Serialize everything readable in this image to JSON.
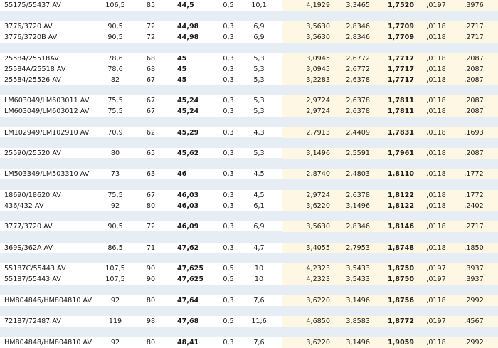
{
  "rows": [
    [
      "55175/55437 AV",
      "106,5",
      "85",
      "44,5",
      "0,5",
      "10,1",
      "4,1929",
      "3,3465",
      "1,7520",
      ",0197",
      ",3976"
    ],
    [
      "3776/3720 AV",
      "90,5",
      "72",
      "44,98",
      "0,3",
      "6,9",
      "3,5630",
      "2,8346",
      "1,7709",
      ",0118",
      ",2717"
    ],
    [
      "3776/3720B AV",
      "90,5",
      "72",
      "44,98",
      "0,3",
      "6,9",
      "3,5630",
      "2,8346",
      "1,7709",
      ",0118",
      ",2717"
    ],
    [
      "25584/25518AV",
      "78,6",
      "68",
      "45",
      "0,3",
      "5,3",
      "3,0945",
      "2,6772",
      "1,7717",
      ",0118",
      ",2087"
    ],
    [
      "25584A/25518 AV",
      "78,6",
      "68",
      "45",
      "0,3",
      "5,3",
      "3,0945",
      "2,6772",
      "1,7717",
      ",0118",
      ",2087"
    ],
    [
      "25584/25526 AV",
      "82",
      "67",
      "45",
      "0,3",
      "5,3",
      "3,2283",
      "2,6378",
      "1,7717",
      ",0118",
      ",2087"
    ],
    [
      "LM603049/LM603011 AV",
      "75,5",
      "67",
      "45,24",
      "0,3",
      "5,3",
      "2,9724",
      "2,6378",
      "1,7811",
      ",0118",
      ",2087"
    ],
    [
      "LM603049/LM603012 AV",
      "75,5",
      "67",
      "45,24",
      "0,3",
      "5,3",
      "2,9724",
      "2,6378",
      "1,7811",
      ",0118",
      ",2087"
    ],
    [
      "LM102949/LM102910 AV",
      "70,9",
      "62",
      "45,29",
      "0,3",
      "4,3",
      "2,7913",
      "2,4409",
      "1,7831",
      ",0118",
      ",1693"
    ],
    [
      "25590/25520 AV",
      "80",
      "65",
      "45,62",
      "0,3",
      "5,3",
      "3,1496",
      "2,5591",
      "1,7961",
      ",0118",
      ",2087"
    ],
    [
      "LM503349/LM503310 AV",
      "73",
      "63",
      "46",
      "0,3",
      "4,5",
      "2,8740",
      "2,4803",
      "1,8110",
      ",0118",
      ",1772"
    ],
    [
      "18690/18620 AV",
      "75,5",
      "67",
      "46,03",
      "0,3",
      "4,5",
      "2,9724",
      "2,6378",
      "1,8122",
      ",0118",
      ",1772"
    ],
    [
      "436/432 AV",
      "92",
      "80",
      "46,03",
      "0,3",
      "6,1",
      "3,6220",
      "3,1496",
      "1,8122",
      ",0118",
      ",2402"
    ],
    [
      "3777/3720 AV",
      "90,5",
      "72",
      "46,09",
      "0,3",
      "6,9",
      "3,5630",
      "2,8346",
      "1,8146",
      ",0118",
      ",2717"
    ],
    [
      "369S/362A AV",
      "86,5",
      "71",
      "47,62",
      "0,3",
      "4,7",
      "3,4055",
      "2,7953",
      "1,8748",
      ",0118",
      ",1850"
    ],
    [
      "55187C/55443 AV",
      "107,5",
      "90",
      "47,625",
      "0,5",
      "10",
      "4,2323",
      "3,5433",
      "1,8750",
      ",0197",
      ",3937"
    ],
    [
      "55187/55443 AV",
      "107,5",
      "90",
      "47,625",
      "0,5",
      "10",
      "4,2323",
      "3,5433",
      "1,8750",
      ",0197",
      ",3937"
    ],
    [
      "HM804846/HM804810 AV",
      "92",
      "80",
      "47,64",
      "0,3",
      "7,6",
      "3,6220",
      "3,1496",
      "1,8756",
      ",0118",
      ",2992"
    ],
    [
      "72187/72487 AV",
      "119",
      "98",
      "47,68",
      "0,5",
      "11,6",
      "4,6850",
      "3,8583",
      "1,8772",
      ",0197",
      ",4567"
    ],
    [
      "HM804848/HM804810 AV",
      "92",
      "80",
      "48,41",
      "0,3",
      "7,6",
      "3,6220",
      "3,1496",
      "1,9059",
      ",0118",
      ",2992"
    ]
  ]
}
